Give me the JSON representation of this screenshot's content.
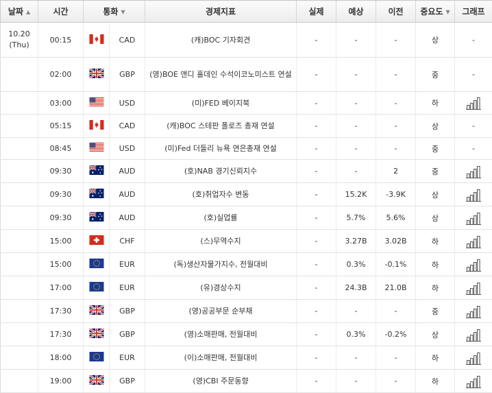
{
  "headers": {
    "date": "날짜",
    "time": "시간",
    "currency": "통화",
    "indicator": "경제지표",
    "actual": "실제",
    "forecast": "예상",
    "previous": "이전",
    "importance": "중요도",
    "graph": "그래프"
  },
  "date_cell": {
    "date": "10.20",
    "day": "(Thu)"
  },
  "rows": [
    {
      "time": "00:15",
      "flag": "ca",
      "currency": "CAD",
      "indicator": "(캐)BOC 기자회견",
      "actual": "-",
      "forecast": "-",
      "previous": "-",
      "importance": "상",
      "graph": "-"
    },
    {
      "time": "02:00",
      "flag": "gb",
      "currency": "GBP",
      "indicator": "(영)BOE 앤디 홀데인 수석이코노미스트 연설",
      "actual": "-",
      "forecast": "-",
      "previous": "-",
      "importance": "중",
      "graph": "-"
    },
    {
      "time": "03:00",
      "flag": "us",
      "currency": "USD",
      "indicator": "(미)FED 베이지북",
      "actual": "-",
      "forecast": "-",
      "previous": "-",
      "importance": "하",
      "graph": "chart-icon"
    },
    {
      "time": "05:15",
      "flag": "ca",
      "currency": "CAD",
      "indicator": "(캐)BOC 스테판 폴로즈 총재 연설",
      "actual": "-",
      "forecast": "-",
      "previous": "-",
      "importance": "상",
      "graph": "-"
    },
    {
      "time": "08:45",
      "flag": "us",
      "currency": "USD",
      "indicator": "(미)Fed 더들리 뉴욕 연은총재 연설",
      "actual": "-",
      "forecast": "-",
      "previous": "-",
      "importance": "중",
      "graph": "-"
    },
    {
      "time": "09:30",
      "flag": "au",
      "currency": "AUD",
      "indicator": "(호)NAB 경기신뢰지수",
      "actual": "-",
      "forecast": "-",
      "previous": "2",
      "importance": "중",
      "graph": "chart-icon"
    },
    {
      "time": "09:30",
      "flag": "au",
      "currency": "AUD",
      "indicator": "(호)취업자수 변동",
      "actual": "-",
      "forecast": "15.2K",
      "previous": "-3.9K",
      "importance": "상",
      "graph": "chart-icon"
    },
    {
      "time": "09:30",
      "flag": "au",
      "currency": "AUD",
      "indicator": "(호)실업률",
      "actual": "-",
      "forecast": "5.7%",
      "previous": "5.6%",
      "importance": "상",
      "graph": "chart-icon"
    },
    {
      "time": "15:00",
      "flag": "ch",
      "currency": "CHF",
      "indicator": "(스)무역수지",
      "actual": "-",
      "forecast": "3.27B",
      "previous": "3.02B",
      "importance": "하",
      "graph": "chart-icon"
    },
    {
      "time": "15:00",
      "flag": "eu",
      "currency": "EUR",
      "indicator": "(독)생산자물가지수, 전월대비",
      "actual": "-",
      "forecast": "0.3%",
      "previous": "-0.1%",
      "importance": "하",
      "graph": "chart-icon"
    },
    {
      "time": "17:00",
      "flag": "eu",
      "currency": "EUR",
      "indicator": "(유)경상수지",
      "actual": "-",
      "forecast": "24.3B",
      "previous": "21.0B",
      "importance": "하",
      "graph": "chart-icon"
    },
    {
      "time": "17:30",
      "flag": "gb",
      "currency": "GBP",
      "indicator": "(영)공공부문 순부채",
      "actual": "-",
      "forecast": "-",
      "previous": "-",
      "importance": "중",
      "graph": "chart-icon"
    },
    {
      "time": "17:30",
      "flag": "gb",
      "currency": "GBP",
      "indicator": "(영)소매판매, 전월대비",
      "actual": "-",
      "forecast": "0.3%",
      "previous": "-0.2%",
      "importance": "상",
      "graph": "chart-icon"
    },
    {
      "time": "18:00",
      "flag": "eu",
      "currency": "EUR",
      "indicator": "(이)소매판매, 전월대비",
      "actual": "-",
      "forecast": "-",
      "previous": "-",
      "importance": "하",
      "graph": "chart-icon"
    },
    {
      "time": "19:00",
      "flag": "gb",
      "currency": "GBP",
      "indicator": "(영)CBI 주문동향",
      "actual": "-",
      "forecast": "-",
      "previous": "-",
      "importance": "하",
      "graph": "chart-icon"
    }
  ],
  "colors": {
    "flag_red": "#d52b1e",
    "flag_blue": "#1f3b8a",
    "us_blue": "#3c3b6e",
    "eu_blue": "#1a3896",
    "au_blue": "#012169"
  }
}
